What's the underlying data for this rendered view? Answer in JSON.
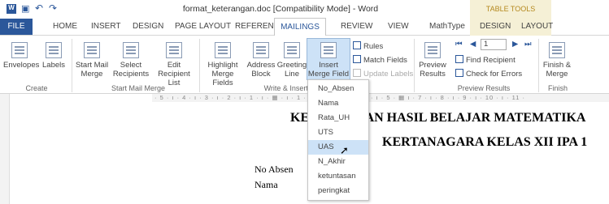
{
  "window": {
    "title": "format_keterangan.doc [Compatibility Mode] - Word",
    "table_tools": "TABLE TOOLS"
  },
  "quick_access": {
    "undo": "↶",
    "redo": "↷",
    "save": "▣"
  },
  "tabs": [
    "FILE",
    "HOME",
    "INSERT",
    "DESIGN",
    "PAGE LAYOUT",
    "REFERENCES",
    "MAILINGS",
    "REVIEW",
    "VIEW",
    "MathType",
    "DESIGN",
    "LAYOUT"
  ],
  "ribbon": {
    "create": {
      "envelopes": "Envelopes",
      "labels": "Labels",
      "group": "Create"
    },
    "start": {
      "start_mail_merge": "Start Mail Merge",
      "select_recipients": "Select Recipients",
      "edit_recipient_list": "Edit Recipient List",
      "group": "Start Mail Merge"
    },
    "write": {
      "highlight": "Highlight Merge Fields",
      "address": "Address Block",
      "greeting": "Greeting Line",
      "insert_merge": "Insert Merge Field",
      "rules": "Rules",
      "match_fields": "Match Fields",
      "update_labels": "Update Labels",
      "group": "Write & Insert Fields"
    },
    "preview": {
      "preview_results": "Preview Results",
      "record": "1",
      "find_recipient": "Find Recipient",
      "check_errors": "Check for Errors",
      "group": "Preview Results"
    },
    "finish": {
      "finish_merge": "Finish & Merge",
      "group": "Finish"
    }
  },
  "ruler": "· 5 · ı · 4 · ı · 3 · ı · 2 · ı · 1 · ı · ▦ · ı · 1 · ı · 2 · ı · 3 · ı · 4 · ı · 5 · ▦ ı · 7 · ı · 8 · ı · 9 · ı · 10 · ı · 11 ·",
  "merge_fields": [
    "No_Absen",
    "Nama",
    "Rata_UH",
    "UTS",
    "UAS",
    "N_Akhir",
    "ketuntasan",
    "peringkat"
  ],
  "selected_field": "UAS",
  "document": {
    "heading1": "KETERANGAN HASIL BELAJAR MATEMATIKA",
    "heading2": "KERTANAGARA KELAS XII IPA 1",
    "field1": "No Absen",
    "field2": "Nama"
  }
}
